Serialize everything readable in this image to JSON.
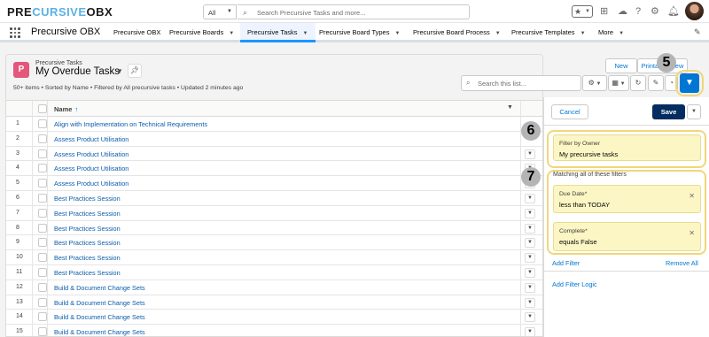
{
  "app": {
    "logo": {
      "part1": "PRE",
      "part2": "CURSIVE",
      "part3": "OBX"
    },
    "name": "Precursive OBX"
  },
  "search": {
    "scope": "All",
    "placeholder": "Search Precursive Tasks and more..."
  },
  "nav": {
    "items": [
      {
        "label": "Precursive OBX",
        "dropdown": false
      },
      {
        "label": "Precursive Boards",
        "dropdown": true
      },
      {
        "label": "Precursive Tasks",
        "dropdown": true
      },
      {
        "label": "Precursive Board Types",
        "dropdown": true
      },
      {
        "label": "Precursive Board Process",
        "dropdown": true
      },
      {
        "label": "Precursive Templates",
        "dropdown": true
      },
      {
        "label": "More",
        "dropdown": true
      }
    ]
  },
  "list": {
    "object_label": "Precursive Tasks",
    "view_name": "My Overdue Tasks",
    "meta": "50+ items • Sorted by Name • Filtered by All precursive tasks • Updated 2 minutes ago",
    "new_label": "New",
    "printable_label": "Printable View",
    "search_placeholder": "Search this list...",
    "column_name": "Name",
    "rows": [
      {
        "num": "1",
        "name": "Align with Implementation on Technical Requirements",
        "action": false
      },
      {
        "num": "2",
        "name": "Assess Product Utilisation",
        "action": false
      },
      {
        "num": "3",
        "name": "Assess Product Utilisation",
        "action": true
      },
      {
        "num": "4",
        "name": "Assess Product Utilisation",
        "action": true
      },
      {
        "num": "5",
        "name": "Assess Product Utilisation",
        "action": true
      },
      {
        "num": "6",
        "name": "Best Practices Session",
        "action": true
      },
      {
        "num": "7",
        "name": "Best Practices Session",
        "action": true
      },
      {
        "num": "8",
        "name": "Best Practices Session",
        "action": true
      },
      {
        "num": "9",
        "name": "Best Practices Session",
        "action": true
      },
      {
        "num": "10",
        "name": "Best Practices Session",
        "action": true
      },
      {
        "num": "11",
        "name": "Best Practices Session",
        "action": true
      },
      {
        "num": "12",
        "name": "Build & Document Change Sets",
        "action": true
      },
      {
        "num": "13",
        "name": "Build & Document Change Sets",
        "action": true
      },
      {
        "num": "14",
        "name": "Build & Document Change Sets",
        "action": true
      },
      {
        "num": "15",
        "name": "Build & Document Change Sets",
        "action": true
      }
    ]
  },
  "filters": {
    "cancel_label": "Cancel",
    "save_label": "Save",
    "owner": {
      "label": "Filter by Owner",
      "value": "My precursive tasks"
    },
    "matching_label": "Matching all of these filters",
    "items": [
      {
        "label": "Due Date*",
        "value": "less than  TODAY"
      },
      {
        "label": "Complete*",
        "value": "equals  False"
      }
    ],
    "add_filter": "Add Filter",
    "remove_all": "Remove All",
    "add_logic": "Add Filter Logic"
  },
  "annotations": {
    "step5": "5",
    "step6": "6",
    "step7": "7"
  },
  "colors": {
    "brand": "#0176d3",
    "save": "#032d60",
    "highlight": "#fbf6c4",
    "ring": "#f1d67a",
    "object_icon": "#e4567a"
  }
}
